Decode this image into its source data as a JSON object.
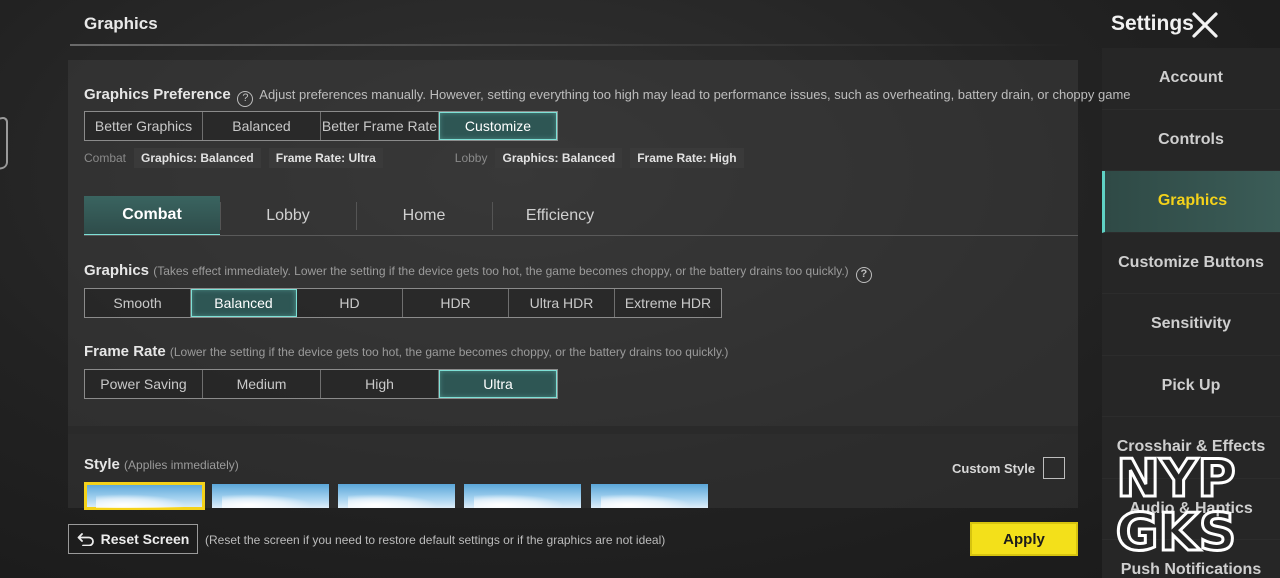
{
  "header": {
    "section_title": "Graphics",
    "settings_title": "Settings"
  },
  "sidebar": {
    "items": [
      {
        "label": "Account",
        "active": false
      },
      {
        "label": "Controls",
        "active": false
      },
      {
        "label": "Graphics",
        "active": true
      },
      {
        "label": "Customize Buttons",
        "active": false
      },
      {
        "label": "Sensitivity",
        "active": false
      },
      {
        "label": "Pick Up",
        "active": false
      },
      {
        "label": "Crosshair & Effects",
        "active": false
      },
      {
        "label": "Audio & Haptics",
        "active": false
      },
      {
        "label": "Push Notifications",
        "active": false
      }
    ]
  },
  "preference": {
    "label": "Graphics Preference",
    "description": "Adjust preferences manually. However, setting everything too high may lead to performance issues, such as overheating, battery drain, or choppy game",
    "options": [
      "Better Graphics",
      "Balanced",
      "Better Frame Rate",
      "Customize"
    ],
    "selected": "Customize"
  },
  "summary": {
    "combat_label": "Combat",
    "combat_graphics": "Graphics: Balanced",
    "combat_frame_rate": "Frame Rate: Ultra",
    "lobby_label": "Lobby",
    "lobby_graphics": "Graphics: Balanced",
    "lobby_frame_rate": "Frame Rate: High"
  },
  "tabs": [
    "Combat",
    "Lobby",
    "Home",
    "Efficiency"
  ],
  "active_tab": "Combat",
  "graphics": {
    "label": "Graphics",
    "note": "(Takes effect immediately. Lower the setting if the device gets too hot, the game becomes choppy, or the battery drains too quickly.)",
    "options": [
      "Smooth",
      "Balanced",
      "HD",
      "HDR",
      "Ultra HDR",
      "Extreme HDR"
    ],
    "selected": "Balanced"
  },
  "frame_rate": {
    "label": "Frame Rate",
    "note": "(Lower the setting if the device gets too hot, the game becomes choppy, or the battery drains too quickly.)",
    "options": [
      "Power Saving",
      "Medium",
      "High",
      "Ultra"
    ],
    "selected": "Ultra"
  },
  "style": {
    "label": "Style",
    "note": "(Applies immediately)",
    "custom_label": "Custom Style",
    "custom_checked": false,
    "selected_index": 0,
    "thumbnail_count": 5
  },
  "footer": {
    "reset_label": "Reset Screen",
    "reset_note": "(Reset the screen if you need to restore default settings or if the graphics are not ideal)",
    "apply_label": "Apply"
  },
  "watermark": {
    "top": "NYP",
    "bottom": "GKS"
  },
  "colors": {
    "accent_teal": "#7ee0d6",
    "selected_fill": "#2e5654",
    "active_yellow": "#f4d21a",
    "apply_yellow": "#f3e01a"
  }
}
